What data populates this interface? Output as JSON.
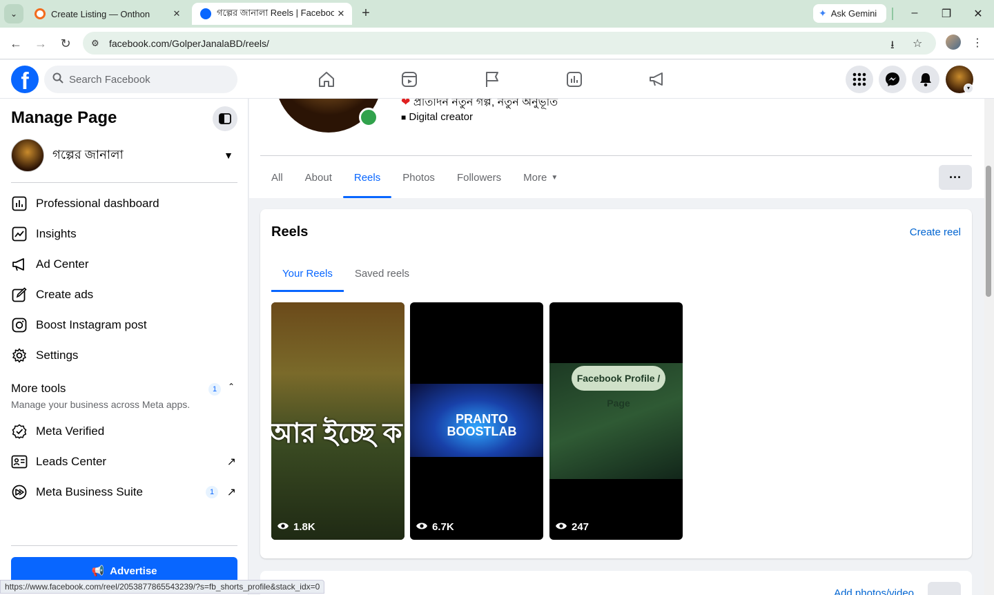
{
  "browser": {
    "tabs": [
      {
        "title": "Create Listing — Onthon",
        "active": false
      },
      {
        "title": "গল্পের জানালা Reels | Facebook",
        "active": true
      }
    ],
    "ask_gemini": "Ask Gemini",
    "url": "facebook.com/GolperJanalaBD/reels/",
    "status_url": "https://www.facebook.com/reel/2053877865543239/?s=fb_shorts_profile&stack_idx=0"
  },
  "header": {
    "logo": "f",
    "search_placeholder": "Search Facebook",
    "nav_icons": [
      "home-icon",
      "video-icon",
      "flag-icon",
      "insights-icon",
      "megaphone-icon"
    ],
    "right_icons": [
      "menu-grid-icon",
      "messenger-icon",
      "notifications-icon"
    ]
  },
  "sidebar": {
    "title": "Manage Page",
    "page_name": "গল্পের জানালা",
    "items": [
      {
        "label": "Professional dashboard",
        "icon": "dashboard-icon"
      },
      {
        "label": "Insights",
        "icon": "insights-icon"
      },
      {
        "label": "Ad Center",
        "icon": "megaphone-icon"
      },
      {
        "label": "Create ads",
        "icon": "pencil-icon"
      },
      {
        "label": "Boost Instagram post",
        "icon": "instagram-icon"
      },
      {
        "label": "Settings",
        "icon": "gear-icon"
      }
    ],
    "more_tools": {
      "title": "More tools",
      "subtitle": "Manage your business across Meta apps.",
      "badge": "1"
    },
    "tools": [
      {
        "label": "Meta Verified",
        "icon": "verified-icon"
      },
      {
        "label": "Leads Center",
        "icon": "leads-icon"
      },
      {
        "label": "Meta Business Suite",
        "icon": "meta-business-icon",
        "badge": "1"
      }
    ],
    "advertise": "Advertise"
  },
  "profile": {
    "bio": "প্রতিদিন নতুন গল্প, নতুন অনুভূতি",
    "category": "Digital creator",
    "tabs": [
      "All",
      "About",
      "Reels",
      "Photos",
      "Followers",
      "More"
    ],
    "active_tab": "Reels"
  },
  "reels": {
    "title": "Reels",
    "create_label": "Create reel",
    "tabs": [
      "Your Reels",
      "Saved reels"
    ],
    "active_tab": "Your Reels",
    "items": [
      {
        "views": "1.8K",
        "caption": "আর ইচ্ছে ক"
      },
      {
        "views": "6.7K",
        "caption": "PRANTO BOOSTLAB"
      },
      {
        "views": "247",
        "caption": "Facebook Profile / Page"
      }
    ]
  },
  "next_section": {
    "action": "Add photos/video"
  }
}
